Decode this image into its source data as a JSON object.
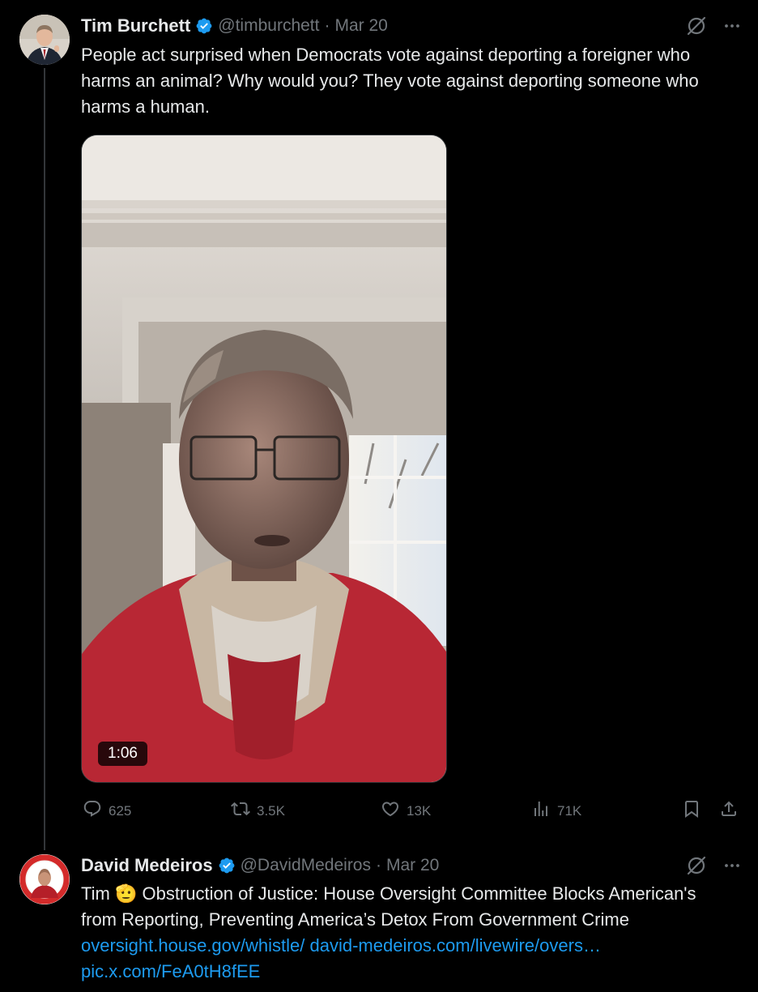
{
  "tweet1": {
    "display_name": "Tim Burchett",
    "handle": "@timburchett",
    "separator": "·",
    "date": "Mar 20",
    "text": "People act surprised when Democrats vote against deporting a foreigner who harms an animal? Why would you? They vote against deporting someone who harms a human.",
    "video_duration": "1:06",
    "stats": {
      "replies": "625",
      "retweets": "3.5K",
      "likes": "13K",
      "views": "71K"
    }
  },
  "tweet2": {
    "display_name": "David Medeiros",
    "handle": "@DavidMedeiros",
    "separator": "·",
    "date": "Mar 20",
    "text_start": "Tim",
    "emoji": "🫡",
    "text_body": "Obstruction of Justice: House Oversight Committee Blocks American's from Reporting, Preventing America’s Detox From Government Crime",
    "link1": "oversight.house.gov/whistle/",
    "link2": "david-medeiros.com/livewire/overs…",
    "link3": "pic.x.com/FeA0tH8fEE"
  },
  "icons": {
    "verified": "verified-badge-icon",
    "grok": "grok-icon",
    "more": "more-icon",
    "reply": "reply-icon",
    "retweet": "retweet-icon",
    "like": "like-icon",
    "views": "views-icon",
    "bookmark": "bookmark-icon",
    "share": "share-icon"
  },
  "colors": {
    "background": "#000000",
    "text": "#e7e9ea",
    "secondary": "#71767b",
    "accent": "#1d9bf0",
    "verified": "#1d9bf0"
  }
}
